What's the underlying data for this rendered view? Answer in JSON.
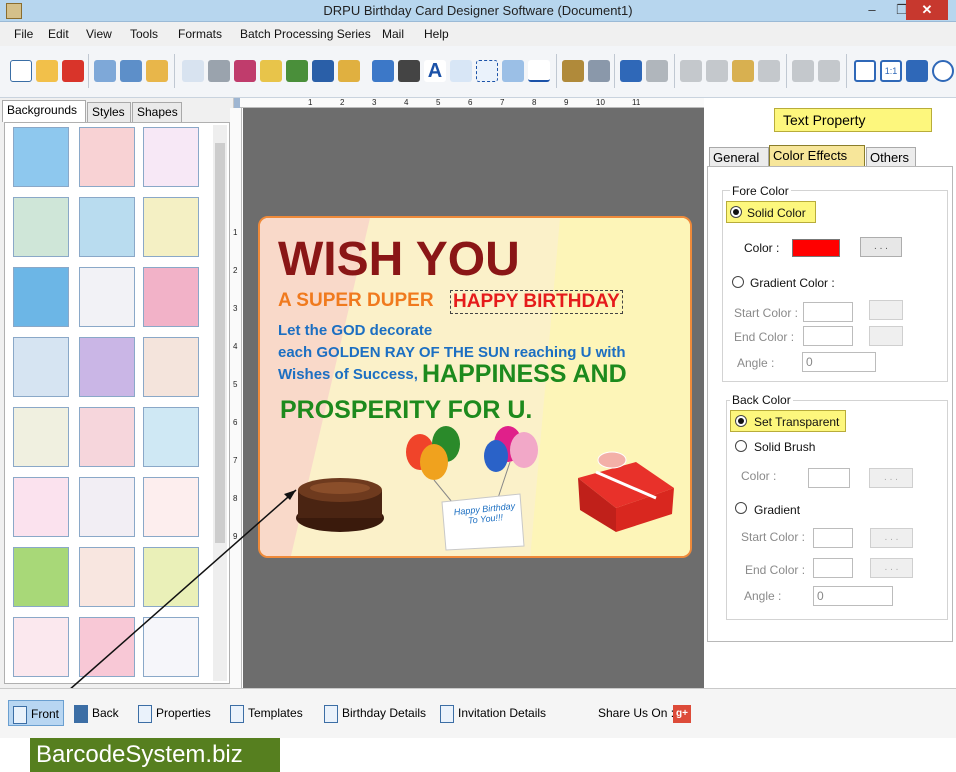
{
  "window": {
    "title": "DRPU Birthday Card Designer Software (Document1)"
  },
  "menu": [
    "File",
    "Edit",
    "View",
    "Tools",
    "Formats",
    "Batch Processing Series",
    "Mail",
    "Help"
  ],
  "left_tabs": [
    "Backgrounds",
    "Styles",
    "Shapes"
  ],
  "ruler": {
    "top_marks": [
      "1",
      "2",
      "3",
      "4",
      "5",
      "6",
      "7",
      "8",
      "9",
      "10",
      "11"
    ],
    "left_marks": [
      "1",
      "2",
      "3",
      "4",
      "5",
      "6",
      "7",
      "8",
      "9"
    ]
  },
  "card": {
    "line1": "WISH YOU",
    "line2a": "A SUPER DUPER",
    "line2b": "HAPPY BIRTHDAY",
    "line3": "Let the GOD decorate",
    "line4": "each GOLDEN RAY OF THE SUN reaching U with",
    "line5a": "Wishes of Success,",
    "line5b": "HAPPINESS AND",
    "line6": "PROSPERITY FOR U.",
    "sign_text": "Happy Birthday To You!!!"
  },
  "right_panel": {
    "header": "Text Property",
    "tabs": [
      "General",
      "Color Effects",
      "Others"
    ],
    "fore": {
      "label": "Fore Color",
      "solid": "Solid Color",
      "color_label": "Color :",
      "color_value": "#ff0000",
      "dots": ". . .",
      "gradient": "Gradient Color :",
      "start": "Start Color :",
      "end": "End Color :",
      "angle": "Angle :",
      "angle_value": "0"
    },
    "back": {
      "label": "Back Color",
      "transparent": "Set Transparent",
      "solid": "Solid Brush",
      "color_label": "Color :",
      "dots": ". . .",
      "gradient": "Gradient",
      "start": "Start Color :",
      "end": "End Color :",
      "angle": "Angle :",
      "angle_value": "0"
    }
  },
  "bottom": {
    "items": [
      "Front",
      "Back",
      "Properties",
      "Templates",
      "Birthday Details",
      "Invitation Details"
    ],
    "share": "Share Us On :",
    "gplus": "g+"
  },
  "watermark": "BarcodeSystem.biz"
}
